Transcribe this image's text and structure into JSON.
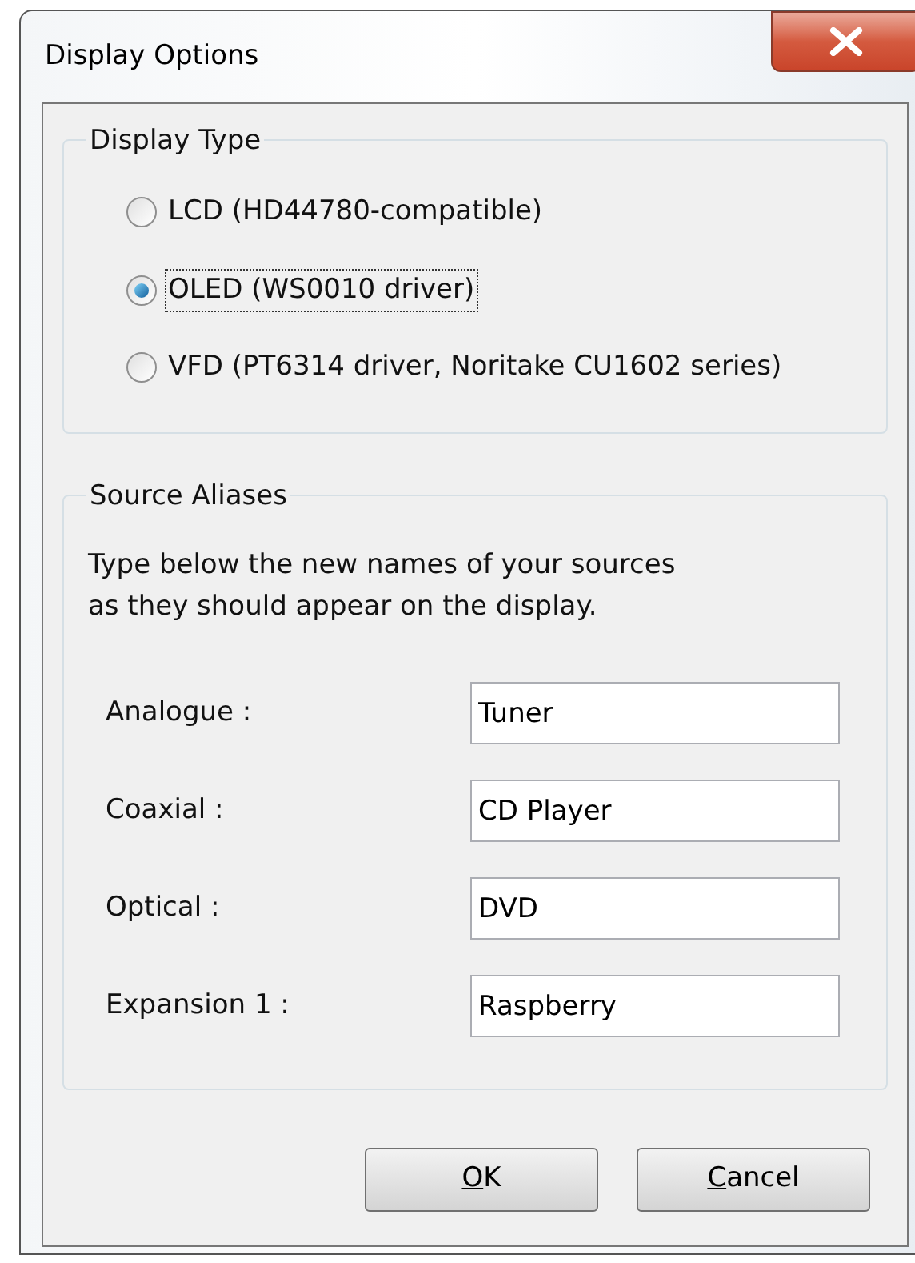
{
  "window": {
    "title": "Display Options"
  },
  "display_type": {
    "title": "Display Type",
    "options": [
      {
        "label": "LCD (HD44780-compatible)",
        "selected": false
      },
      {
        "label": "OLED (WS0010 driver)",
        "selected": true
      },
      {
        "label": "VFD (PT6314 driver, Noritake CU1602 series)",
        "selected": false
      }
    ]
  },
  "source_aliases": {
    "title": "Source Aliases",
    "description": "Type below the new names of your sources\nas they should appear on the display.",
    "fields": [
      {
        "label": "Analogue :",
        "value": "Tuner"
      },
      {
        "label": "Coaxial :",
        "value": "CD Player"
      },
      {
        "label": "Optical :",
        "value": "DVD"
      },
      {
        "label": "Expansion 1 :",
        "value": "Raspberry"
      }
    ]
  },
  "buttons": [
    "OK",
    "Cancel"
  ]
}
